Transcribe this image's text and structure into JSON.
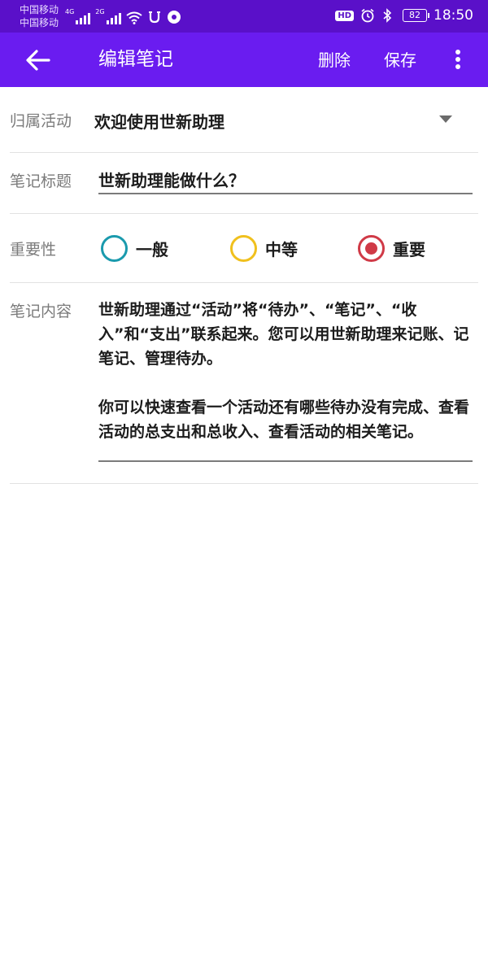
{
  "status_bar": {
    "carrier_1": "中国移动",
    "carrier_2": "中国移动",
    "net_1": "4G",
    "net_2": "2G",
    "hd": "HD",
    "battery": "82",
    "time": "18:50"
  },
  "app_bar": {
    "back_icon": "arrow-left",
    "title": "编辑笔记",
    "delete_label": "删除",
    "save_label": "保存",
    "more_icon": "more-vertical",
    "color": "#6a1cf0"
  },
  "form": {
    "activity": {
      "label": "归属活动",
      "value": "欢迎使用世新助理"
    },
    "title": {
      "label": "笔记标题",
      "value": "世新助理能做什么？"
    },
    "importance": {
      "label": "重要性",
      "options": [
        {
          "label": "一般",
          "color": "#1a9aad",
          "selected": false
        },
        {
          "label": "中等",
          "color": "#f0c01d",
          "selected": false
        },
        {
          "label": "重要",
          "color": "#d03a47",
          "selected": true
        }
      ]
    },
    "content": {
      "label": "笔记内容",
      "value": "世新助理通过“活动”将“待办”、“笔记”、“收入”和“支出”联系起来。您可以用世新助理来记账、记笔记、管理待办。\n\n你可以快速查看一个活动还有哪些待办没有完成、查看活动的总支出和总收入、查看活动的相关笔记。"
    }
  }
}
